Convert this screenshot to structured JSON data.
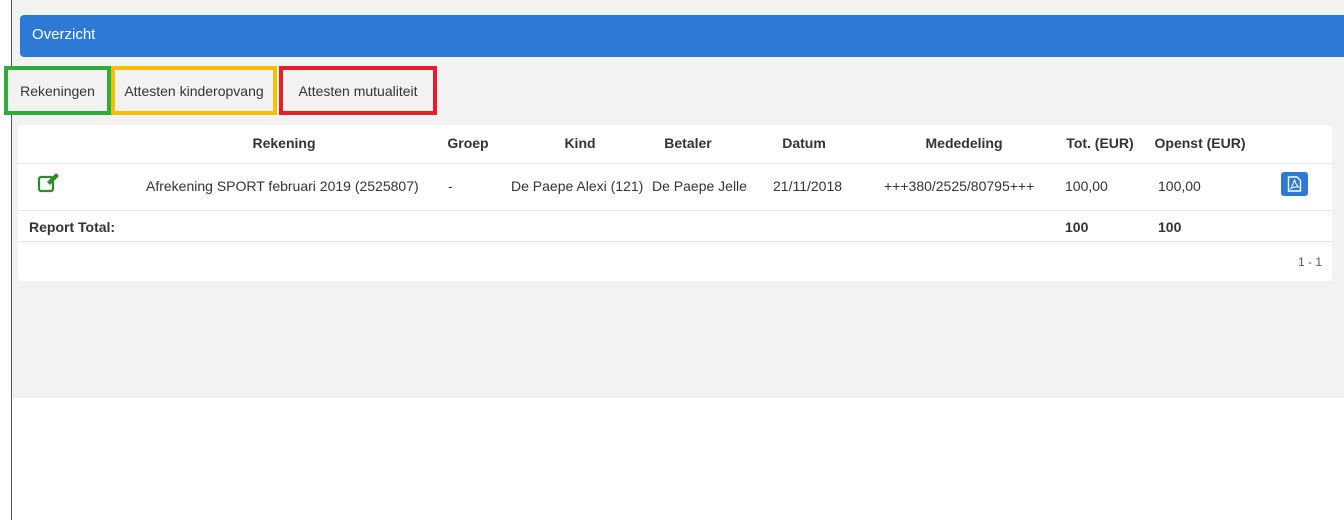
{
  "header": {
    "title": "Overzicht"
  },
  "tabs": [
    {
      "label": "Rekeningen",
      "highlight": "#2eac3a"
    },
    {
      "label": "Attesten kinderopvang",
      "highlight": "#f5c000"
    },
    {
      "label": "Attesten mutualiteit",
      "highlight": "#e51f29"
    }
  ],
  "table": {
    "columns": [
      "Rekening",
      "Groep",
      "Kind",
      "Betaler",
      "Datum",
      "Mededeling",
      "Tot. (EUR)",
      "Openst (EUR)"
    ],
    "rows": [
      {
        "rekening": "Afrekening SPORT februari 2019 (2525807)",
        "groep": "-",
        "kind": "De Paepe Alexi (121)",
        "betaler": "De Paepe Jelle",
        "datum": "21/11/2018",
        "mededeling": "+++380/2525/80795+++",
        "tot": "100,00",
        "openst": "100,00",
        "edit_icon": "edit-icon",
        "pdf_icon": "pdf-icon"
      }
    ],
    "report_total": {
      "label": "Report Total:",
      "tot": "100",
      "openst": "100"
    },
    "pagination": "1 - 1"
  },
  "colors": {
    "header": "#2c7ad6",
    "edit_icon": "#2e8b2e",
    "pdf_button": "#2c7ad6"
  }
}
